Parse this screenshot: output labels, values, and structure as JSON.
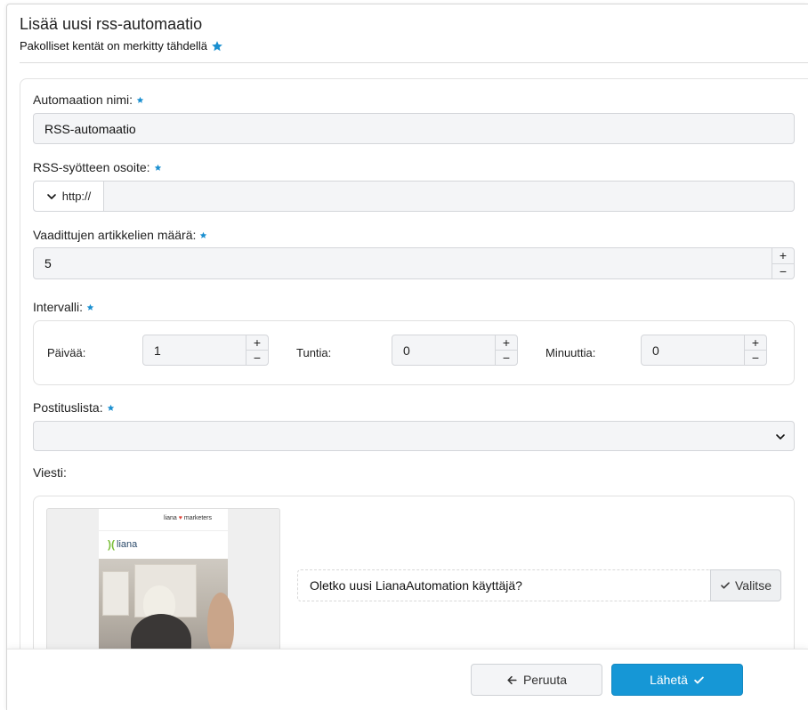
{
  "dialog": {
    "title": "Lisää uusi rss-automaatio",
    "subtitle": "Pakolliset kentät on merkitty tähdellä"
  },
  "fields": {
    "name": {
      "label": "Automaation nimi:",
      "value": "RSS-automaatio"
    },
    "rss_url": {
      "label": "RSS-syötteen osoite:",
      "prefix": "http://",
      "value": ""
    },
    "article_count": {
      "label": "Vaadittujen artikkelien määrä:",
      "value": "5"
    },
    "interval": {
      "label": "Intervalli:",
      "days": {
        "label": "Päivää:",
        "value": "1"
      },
      "hours": {
        "label": "Tuntia:",
        "value": "0"
      },
      "minutes": {
        "label": "Minuuttia:",
        "value": "0"
      }
    },
    "mailing_list": {
      "label": "Postituslista:",
      "value": ""
    },
    "message": {
      "label": "Viesti:",
      "preview_header": "liana",
      "preview_header_suffix": "marketers",
      "preview_logo": "liana",
      "selected_text": "Oletko uusi LianaAutomation käyttäjä?",
      "choose_label": "Valitse"
    }
  },
  "stepper": {
    "plus": "+",
    "minus": "−"
  },
  "footer": {
    "cancel_label": "Peruuta",
    "submit_label": "Lähetä"
  },
  "colors": {
    "accent": "#1697d6",
    "star": "#1a8fd0"
  }
}
